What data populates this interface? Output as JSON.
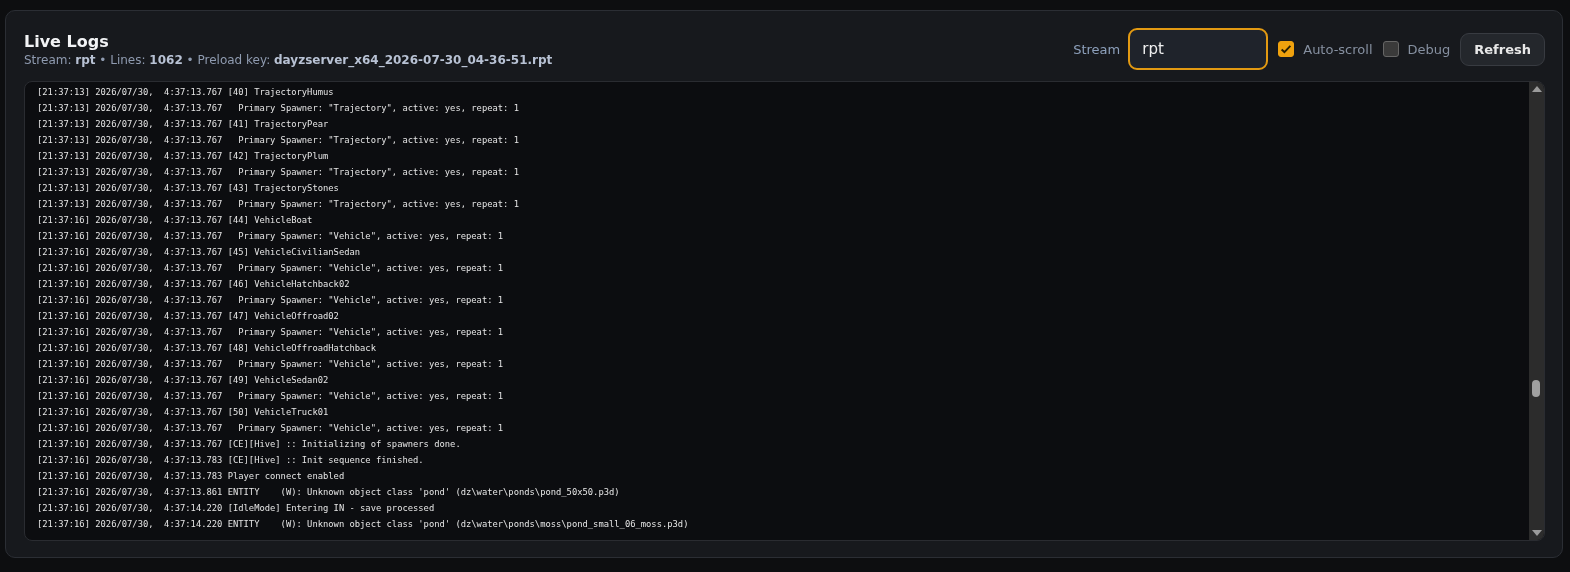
{
  "title": "Live Logs",
  "subtitle": "Stream: **rpt** • Lines: **1062** • Preload key: **dayzserver_x64_2026-07-30_04-36-51.rpt**",
  "stream_label": "Stream",
  "stream_value": "rpt",
  "toggles": [
    {
      "label": "Auto-scroll",
      "checked": true
    },
    {
      "label": "Debug",
      "checked": false
    }
  ],
  "refresh_button": "Refresh",
  "log_lines": [
    "[21:37:13] 2026/07/30,  4:37:13.767 [40] TrajectoryHumus",
    "[21:37:13] 2026/07/30,  4:37:13.767   Primary Spawner: \"Trajectory\", active: yes, repeat: 1",
    "[21:37:13] 2026/07/30,  4:37:13.767 [41] TrajectoryPear",
    "[21:37:13] 2026/07/30,  4:37:13.767   Primary Spawner: \"Trajectory\", active: yes, repeat: 1",
    "[21:37:13] 2026/07/30,  4:37:13.767 [42] TrajectoryPlum",
    "[21:37:13] 2026/07/30,  4:37:13.767   Primary Spawner: \"Trajectory\", active: yes, repeat: 1",
    "[21:37:13] 2026/07/30,  4:37:13.767 [43] TrajectoryStones",
    "[21:37:13] 2026/07/30,  4:37:13.767   Primary Spawner: \"Trajectory\", active: yes, repeat: 1",
    "[21:37:16] 2026/07/30,  4:37:13.767 [44] VehicleBoat",
    "[21:37:16] 2026/07/30,  4:37:13.767   Primary Spawner: \"Vehicle\", active: yes, repeat: 1",
    "[21:37:16] 2026/07/30,  4:37:13.767 [45] VehicleCivilianSedan",
    "[21:37:16] 2026/07/30,  4:37:13.767   Primary Spawner: \"Vehicle\", active: yes, repeat: 1",
    "[21:37:16] 2026/07/30,  4:37:13.767 [46] VehicleHatchback02",
    "[21:37:16] 2026/07/30,  4:37:13.767   Primary Spawner: \"Vehicle\", active: yes, repeat: 1",
    "[21:37:16] 2026/07/30,  4:37:13.767 [47] VehicleOffroad02",
    "[21:37:16] 2026/07/30,  4:37:13.767   Primary Spawner: \"Vehicle\", active: yes, repeat: 1",
    "[21:37:16] 2026/07/30,  4:37:13.767 [48] VehicleOffroadHatchback",
    "[21:37:16] 2026/07/30,  4:37:13.767   Primary Spawner: \"Vehicle\", active: yes, repeat: 1",
    "[21:37:16] 2026/07/30,  4:37:13.767 [49] VehicleSedan02",
    "[21:37:16] 2026/07/30,  4:37:13.767   Primary Spawner: \"Vehicle\", active: yes, repeat: 1",
    "[21:37:16] 2026/07/30,  4:37:13.767 [50] VehicleTruck01",
    "[21:37:16] 2026/07/30,  4:37:13.767   Primary Spawner: \"Vehicle\", active: yes, repeat: 1",
    "[21:37:16] 2026/07/30,  4:37:13.767 [CE][Hive] :: Initializing of spawners done.",
    "[21:37:16] 2026/07/30,  4:37:13.783 [CE][Hive] :: Init sequence finished.",
    "[21:37:16] 2026/07/30,  4:37:13.783 Player connect enabled",
    "[21:37:16] 2026/07/30,  4:37:13.861 ENTITY    (W): Unknown object class 'pond' (dz\\water\\ponds\\pond_50x50.p3d)",
    "[21:37:16] 2026/07/30,  4:37:14.220 [IdleMode] Entering IN - save processed",
    "[21:37:16] 2026/07/30,  4:37:14.220 ENTITY    (W): Unknown object class 'pond' (dz\\water\\ponds\\moss\\pond_small_06_moss.p3d)"
  ]
}
